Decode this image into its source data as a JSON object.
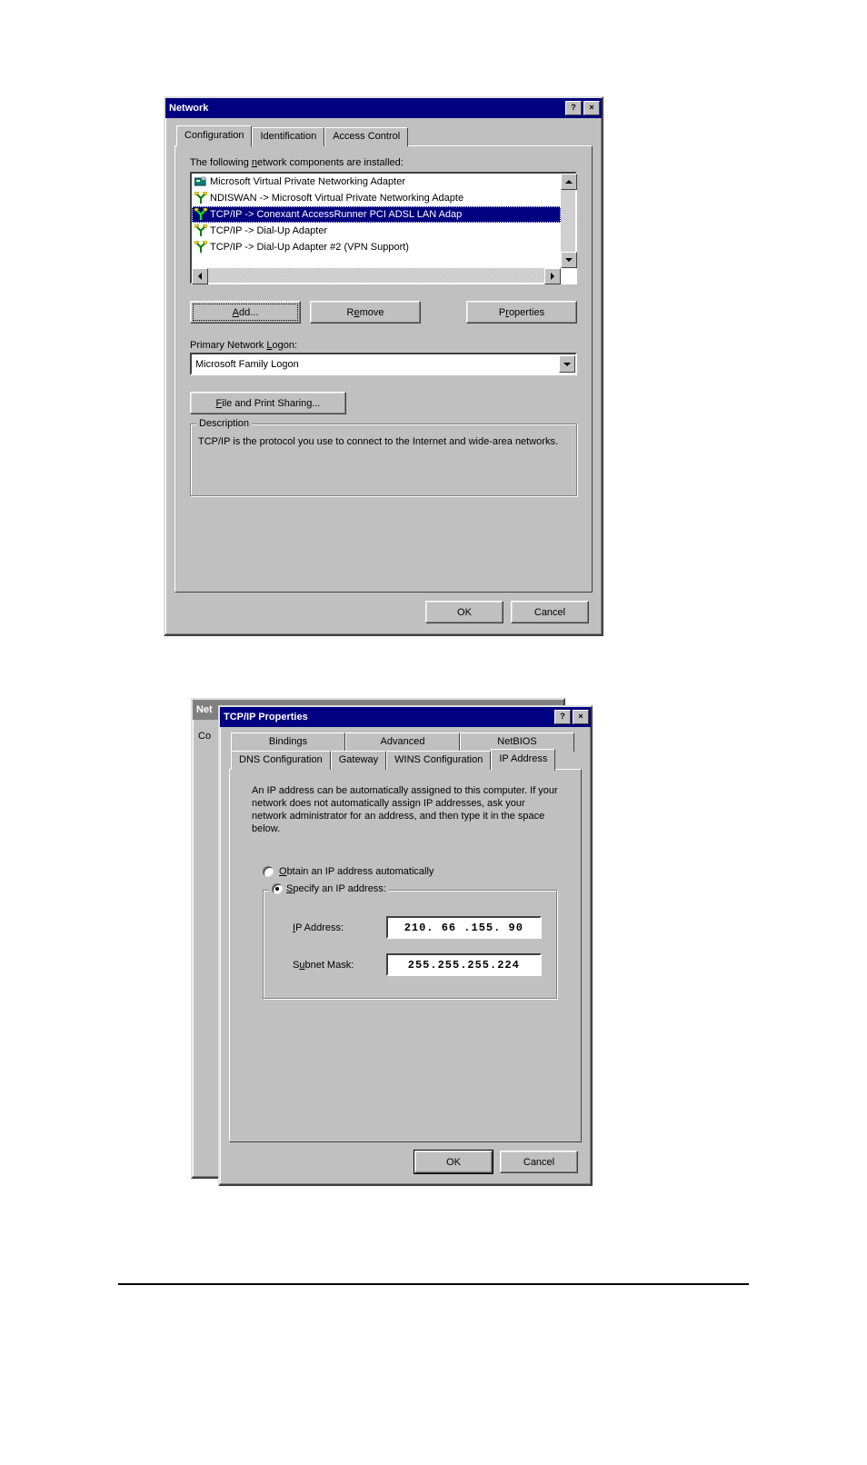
{
  "network_dialog": {
    "title": "Network",
    "tabs": {
      "configuration": "Configuration",
      "identification": "Identification",
      "access_control": "Access Control"
    },
    "components_label": "The following network components are installed:",
    "components": [
      "Microsoft Virtual Private Networking Adapter",
      "NDISWAN -> Microsoft Virtual Private Networking Adapte",
      "TCP/IP -> Conexant AccessRunner PCI ADSL LAN Adap",
      "TCP/IP -> Dial-Up Adapter",
      "TCP/IP -> Dial-Up Adapter #2 (VPN Support)"
    ],
    "selected_index": 2,
    "buttons": {
      "add": "Add...",
      "remove": "Remove",
      "properties": "Properties"
    },
    "primary_logon_label": "Primary Network Logon:",
    "primary_logon_value": "Microsoft Family Logon",
    "file_print_sharing": "File and Print Sharing...",
    "description_label": "Description",
    "description_text": "TCP/IP is the protocol you use to connect to the Internet and wide-area networks.",
    "ok": "OK",
    "cancel": "Cancel"
  },
  "tcpip_dialog": {
    "bg_title": "Net",
    "bg_prefix": "Co",
    "title": "TCP/IP Properties",
    "tabs_top": {
      "bindings": "Bindings",
      "advanced": "Advanced",
      "netbios": "NetBIOS"
    },
    "tabs_bot": {
      "dns": "DNS Configuration",
      "gateway": "Gateway",
      "wins": "WINS Configuration",
      "ipaddr": "IP Address"
    },
    "intro": "An IP address can be automatically assigned to this computer. If your network does not automatically assign IP addresses, ask your network administrator for an address, and then type it in the space below.",
    "radio_auto": "Obtain an IP address automatically",
    "radio_specify": "Specify an IP address:",
    "ip_label": "IP Address:",
    "ip_value": "210. 66 .155. 90",
    "subnet_label": "Subnet Mask:",
    "subnet_value": "255.255.255.224",
    "ok": "OK",
    "cancel": "Cancel"
  }
}
